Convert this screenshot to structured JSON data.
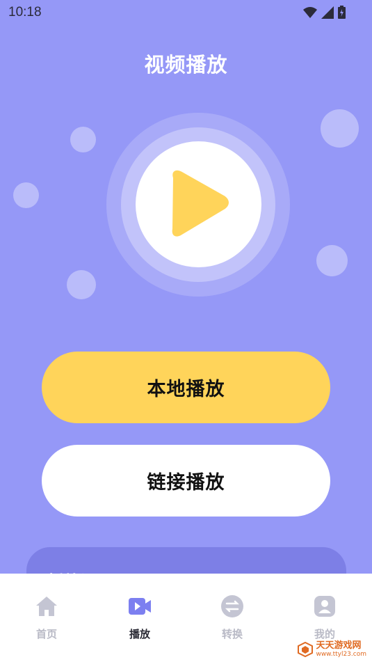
{
  "status_bar": {
    "time": "10:18"
  },
  "header": {
    "title": "视频播放"
  },
  "actions": {
    "local_play": "本地播放",
    "link_play": "链接播放"
  },
  "history": {
    "title": "播放记录"
  },
  "tabs": [
    {
      "label": "首页",
      "icon": "home-icon",
      "active": false
    },
    {
      "label": "播放",
      "icon": "video-icon",
      "active": true
    },
    {
      "label": "转换",
      "icon": "convert-icon",
      "active": false
    },
    {
      "label": "我的",
      "icon": "profile-icon",
      "active": false
    }
  ],
  "watermark": {
    "text": "天天游戏网",
    "sub": "www.ttyl23.com"
  },
  "colors": {
    "background": "#9598f7",
    "accent_yellow": "#ffd45a",
    "tab_active": "#7c7ff0",
    "tab_inactive": "#c4c5d3"
  }
}
